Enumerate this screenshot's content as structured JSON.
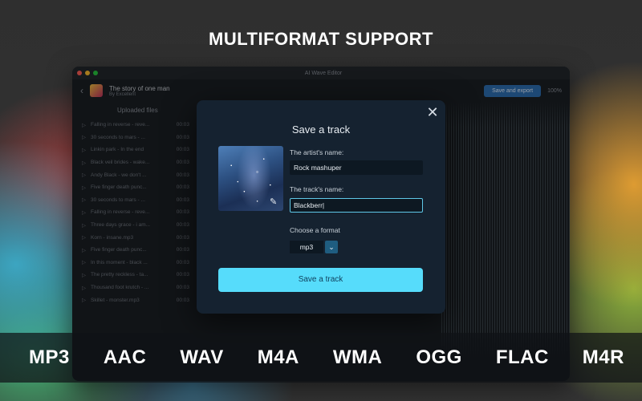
{
  "headline": "MULTIFORMAT SUPPORT",
  "app": {
    "window_title": "AI Wave Editor",
    "track_title": "The story of one man",
    "track_artist": "By Excellent",
    "save_export_label": "Save and export",
    "zoom_label": "100%",
    "sidebar_header": "Uploaded files",
    "files": [
      {
        "name": "Falling in reverse - reve...",
        "dur": "00:03"
      },
      {
        "name": "30 seconds to mars - ...",
        "dur": "00:03"
      },
      {
        "name": "Linkin park - In the end",
        "dur": "00:03"
      },
      {
        "name": "Black veil brides - wake...",
        "dur": "00:03"
      },
      {
        "name": "Andy Black - we don't ...",
        "dur": "00:03"
      },
      {
        "name": "Five finger death punc...",
        "dur": "00:03"
      },
      {
        "name": "30 seconds to mars - ...",
        "dur": "00:03"
      },
      {
        "name": "Falling in reverse - reve...",
        "dur": "00:03"
      },
      {
        "name": "Three days grace - i am...",
        "dur": "00:03"
      },
      {
        "name": "Korn - insane.mp3",
        "dur": "00:03"
      },
      {
        "name": "Five finger death punc...",
        "dur": "00:03"
      },
      {
        "name": "In this moment - black ...",
        "dur": "00:03"
      },
      {
        "name": "The pretty reckless - ta...",
        "dur": "00:03"
      },
      {
        "name": "Thousand foot krutch - ...",
        "dur": "00:03"
      },
      {
        "name": "Skillet - monster.mp3",
        "dur": "00:03"
      }
    ]
  },
  "modal": {
    "title": "Save a track",
    "close_glyph": "✕",
    "edit_glyph": "✎",
    "artist_label": "The artist's name:",
    "artist_value": "Rock mashuper",
    "track_label": "The track's name:",
    "track_value": "Blackberr|",
    "format_label": "Choose a format",
    "format_value": "mp3",
    "format_chevron": "⌄",
    "save_label": "Save a track"
  },
  "formats": [
    "MP3",
    "AAC",
    "WAV",
    "M4A",
    "WMA",
    "OGG",
    "FLAC",
    "M4R"
  ]
}
